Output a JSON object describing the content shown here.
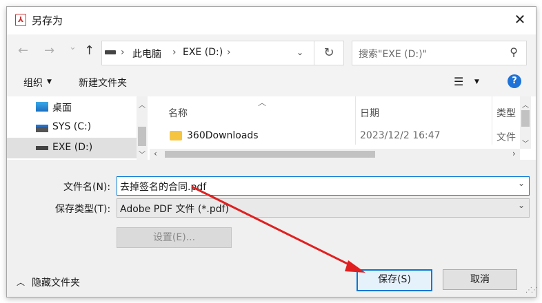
{
  "window": {
    "title": "另存为"
  },
  "nav": {
    "back": "←",
    "forward": "→",
    "recent": "⌄",
    "up": "↑",
    "breadcrumb": [
      "此电脑",
      "EXE (D:)"
    ],
    "refresh": "↻",
    "search_placeholder": "搜索\"EXE (D:)\""
  },
  "toolbar": {
    "organize": "组织",
    "new_folder": "新建文件夹",
    "help": "?"
  },
  "sidebar": {
    "items": [
      {
        "label": "桌面",
        "selected": false
      },
      {
        "label": "SYS (C:)",
        "selected": false
      },
      {
        "label": "EXE (D:)",
        "selected": true
      }
    ]
  },
  "file_list": {
    "columns": [
      "名称",
      "日期",
      "类型"
    ],
    "rows": [
      {
        "name": "360Downloads",
        "date": "2023/12/2 16:47",
        "type": "文件"
      }
    ]
  },
  "form": {
    "filename_label": "文件名(N):",
    "filename_value": "去掉签名的合同.pdf",
    "filetype_label": "保存类型(T):",
    "filetype_value": "Adobe PDF 文件 (*.pdf)",
    "settings_button": "设置(E)..."
  },
  "footer": {
    "hide_folders": "隐藏文件夹",
    "save_button": "保存(S)",
    "cancel_button": "取消"
  },
  "colors": {
    "accent": "#0078d7",
    "annotation_arrow": "#e02020",
    "pdf_icon": "#d03030",
    "folder": "#f5c542"
  }
}
